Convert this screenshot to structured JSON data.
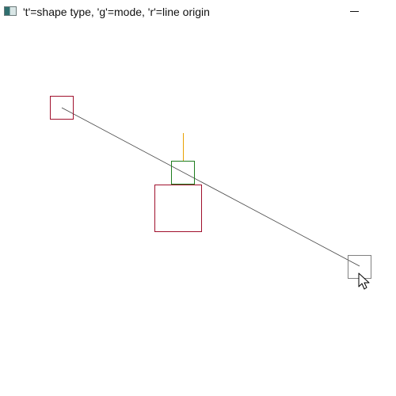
{
  "window": {
    "title": "'t'=shape type, 'g'=mode, 'r'=line origin"
  },
  "colors": {
    "outline_red": "#a0102c",
    "outline_green": "#1e7d1e",
    "stem_orange": "#e8a100",
    "line_dark": "#444444",
    "outline_gray": "#808080"
  },
  "icons": {
    "app": "app-window-icon",
    "minimize": "minimize-icon",
    "cursor": "mouse-pointer-icon"
  }
}
